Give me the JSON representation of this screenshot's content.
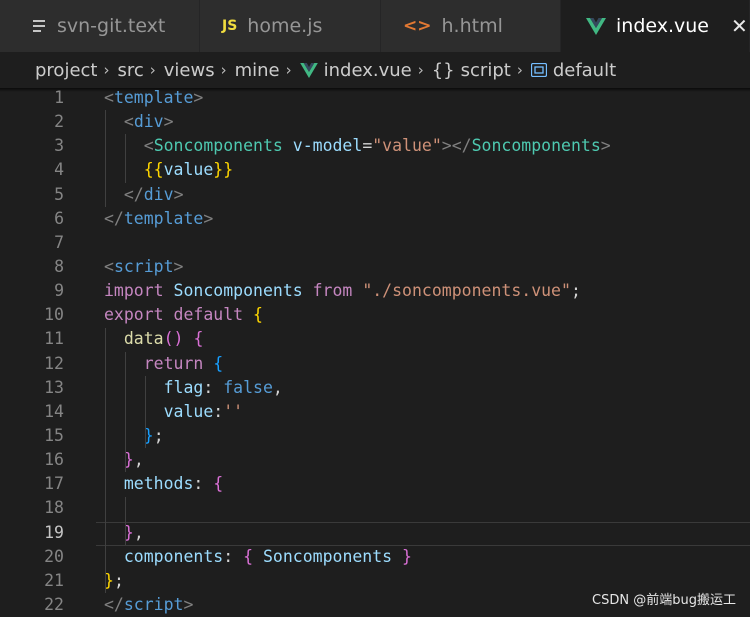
{
  "tabs": [
    {
      "label": "svn-git.text",
      "icon": "text-file-icon",
      "color": "#c5c5c5"
    },
    {
      "label": "home.js",
      "icon": "js-file-icon",
      "color": "#f1dd3f"
    },
    {
      "label": "h.html",
      "icon": "html-file-icon",
      "color": "#e37933"
    },
    {
      "label": "index.vue",
      "icon": "vue-file-icon",
      "color": "#41b883",
      "close": "✕"
    }
  ],
  "breadcrumb": {
    "items": [
      "project",
      "src",
      "views",
      "mine",
      "index.vue",
      "script",
      "default"
    ],
    "separator": "›",
    "script_icon": "{}",
    "vue_color": "#41b883",
    "symbol_color": "#75beff"
  },
  "editor": {
    "active_line": 19,
    "lines": [
      {
        "n": "1",
        "segs": [
          [
            "<",
            "#808080"
          ],
          [
            "template",
            "#569cd6"
          ],
          [
            ">",
            "#808080"
          ]
        ]
      },
      {
        "n": "2",
        "segs": [
          [
            "  ",
            ""
          ],
          [
            "<",
            "#808080"
          ],
          [
            "div",
            "#569cd6"
          ],
          [
            ">",
            "#808080"
          ]
        ]
      },
      {
        "n": "3",
        "segs": [
          [
            "    ",
            ""
          ],
          [
            "<",
            "#808080"
          ],
          [
            "Soncomponents",
            "#4ec9b0"
          ],
          [
            " ",
            ""
          ],
          [
            "v-model",
            "#9cdcfe"
          ],
          [
            "=",
            "#d4d4d4"
          ],
          [
            "\"value\"",
            "#ce9178"
          ],
          [
            "></",
            "#808080"
          ],
          [
            "Soncomponents",
            "#4ec9b0"
          ],
          [
            ">",
            "#808080"
          ]
        ]
      },
      {
        "n": "4",
        "segs": [
          [
            "    ",
            ""
          ],
          [
            "{{",
            "#ffd700"
          ],
          [
            "value",
            "#9cdcfe"
          ],
          [
            "}}",
            "#ffd700"
          ]
        ]
      },
      {
        "n": "5",
        "segs": [
          [
            "  ",
            ""
          ],
          [
            "</",
            "#808080"
          ],
          [
            "div",
            "#569cd6"
          ],
          [
            ">",
            "#808080"
          ]
        ]
      },
      {
        "n": "6",
        "segs": [
          [
            "</",
            "#808080"
          ],
          [
            "template",
            "#569cd6"
          ],
          [
            ">",
            "#808080"
          ]
        ]
      },
      {
        "n": "7",
        "segs": []
      },
      {
        "n": "8",
        "segs": [
          [
            "<",
            "#808080"
          ],
          [
            "script",
            "#569cd6"
          ],
          [
            ">",
            "#808080"
          ]
        ]
      },
      {
        "n": "9",
        "segs": [
          [
            "import",
            "#c586c0"
          ],
          [
            " ",
            ""
          ],
          [
            "Soncomponents",
            "#9cdcfe"
          ],
          [
            " ",
            ""
          ],
          [
            "from",
            "#c586c0"
          ],
          [
            " ",
            ""
          ],
          [
            "\"./soncomponents.vue\"",
            "#ce9178"
          ],
          [
            ";",
            "#d4d4d4"
          ]
        ]
      },
      {
        "n": "10",
        "segs": [
          [
            "export",
            "#c586c0"
          ],
          [
            " ",
            ""
          ],
          [
            "default",
            "#c586c0"
          ],
          [
            " ",
            ""
          ],
          [
            "{",
            "#ffd700"
          ]
        ]
      },
      {
        "n": "11",
        "segs": [
          [
            "  ",
            ""
          ],
          [
            "data",
            "#dcdcaa"
          ],
          [
            "()",
            "#da70d6"
          ],
          [
            " ",
            ""
          ],
          [
            "{",
            "#da70d6"
          ]
        ]
      },
      {
        "n": "12",
        "segs": [
          [
            "    ",
            ""
          ],
          [
            "return",
            "#c586c0"
          ],
          [
            " ",
            ""
          ],
          [
            "{",
            "#179fff"
          ]
        ]
      },
      {
        "n": "13",
        "segs": [
          [
            "      ",
            ""
          ],
          [
            "flag",
            "#9cdcfe"
          ],
          [
            ": ",
            "#d4d4d4"
          ],
          [
            "false",
            "#569cd6"
          ],
          [
            ",",
            "#d4d4d4"
          ]
        ]
      },
      {
        "n": "14",
        "segs": [
          [
            "      ",
            ""
          ],
          [
            "value",
            "#9cdcfe"
          ],
          [
            ":",
            "#d4d4d4"
          ],
          [
            "''",
            "#ce9178"
          ]
        ]
      },
      {
        "n": "15",
        "segs": [
          [
            "    ",
            ""
          ],
          [
            "}",
            "#179fff"
          ],
          [
            ";",
            "#d4d4d4"
          ]
        ]
      },
      {
        "n": "16",
        "segs": [
          [
            "  ",
            ""
          ],
          [
            "}",
            "#da70d6"
          ],
          [
            ",",
            "#d4d4d4"
          ]
        ]
      },
      {
        "n": "17",
        "segs": [
          [
            "  ",
            ""
          ],
          [
            "methods",
            "#9cdcfe"
          ],
          [
            ": ",
            "#d4d4d4"
          ],
          [
            "{",
            "#da70d6"
          ]
        ]
      },
      {
        "n": "18",
        "segs": []
      },
      {
        "n": "19",
        "segs": [
          [
            "  ",
            ""
          ],
          [
            "}",
            "#da70d6"
          ],
          [
            ",",
            "#d4d4d4"
          ]
        ]
      },
      {
        "n": "20",
        "segs": [
          [
            "  ",
            ""
          ],
          [
            "components",
            "#9cdcfe"
          ],
          [
            ": ",
            "#d4d4d4"
          ],
          [
            "{",
            "#da70d6"
          ],
          [
            " ",
            ""
          ],
          [
            "Soncomponents",
            "#9cdcfe"
          ],
          [
            " ",
            ""
          ],
          [
            "}",
            "#da70d6"
          ]
        ]
      },
      {
        "n": "21",
        "segs": [
          [
            "}",
            "#ffd700"
          ],
          [
            ";",
            "#d4d4d4"
          ]
        ]
      },
      {
        "n": "22",
        "segs": [
          [
            "</",
            "#808080"
          ],
          [
            "script",
            "#569cd6"
          ],
          [
            ">",
            "#808080"
          ]
        ]
      }
    ]
  },
  "watermark": "CSDN @前端bug搬运工"
}
